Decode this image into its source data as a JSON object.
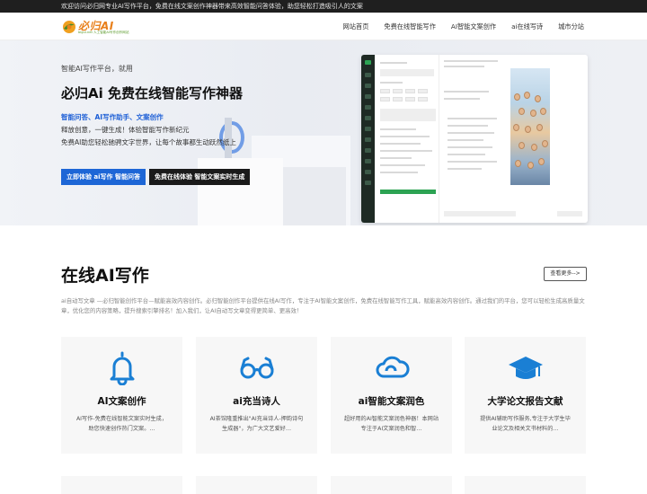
{
  "topbar": {
    "text": "欢迎访问必归网专业AI写作平台，免费在线文案创作神器带来高效智能问答体验，助您轻松打造吸引人的文案"
  },
  "brand": {
    "name": "必归AI",
    "tagline": "bigui.net 人工智能AI写作创作网站"
  },
  "nav": {
    "items": [
      {
        "label": "网站首页"
      },
      {
        "label": "免费在线智能写作"
      },
      {
        "label": "AI智能文案创作"
      },
      {
        "label": "ai在线写诗"
      },
      {
        "label": "城市分站"
      }
    ]
  },
  "hero": {
    "tag": "智能AI写作平台，就用",
    "title": "必归Ai 免费在线智能写作神器",
    "features": "智能问答、AI写作助手、文案创作",
    "line1": "释放创意，一键生成！体验智能写作新纪元",
    "line2": "免费AI助您轻松驰骋文字世界，让每个故事都生动跃然纸上",
    "btn_primary": "立即体验 ai写作 智能问答",
    "btn_secondary": "免费在线体验 智能文案实时生成"
  },
  "section": {
    "title": "在线AI写作",
    "more_label": "查看更多-->",
    "description": "ai自动写文章 —必归智能创作平台—赋能高效内容创作。必归智能创作平台提供在线AI写作，专注于AI智能文案创作，免费在线智能写作工具，赋能高效内容创作。通过我们的平台，您可以轻松生成高质量文章，优化您的内容策略，提升搜索引擎排名！加入我们，让AI自动写文章变得更简单、更高效！"
  },
  "cards": [
    {
      "title": "AI文案创作",
      "text": "AI写作-免费在线智能文案实时生成，助您快速创作热门文案。…",
      "icon": "bell-icon"
    },
    {
      "title": "ai充当诗人",
      "text": "AI茶馆隆重推出\"AI充当诗人-押韵诗句生成器\"，为广大文艺爱好…",
      "icon": "glasses-icon"
    },
    {
      "title": "ai智能文案润色",
      "text": "超好用的AI智能文案润色神器！本网站专注于AI文案润色和智…",
      "icon": "cloud-icon"
    },
    {
      "title": "大学论文报告文献",
      "text": "提供AI辅助写作服务,专注于大学生毕业论文及相关文书材料的…",
      "icon": "graduation-cap-icon"
    }
  ],
  "colors": {
    "accent": "#1d66d6",
    "brand_orange": "#e8801c",
    "icon_blue": "#1a7fd4"
  }
}
